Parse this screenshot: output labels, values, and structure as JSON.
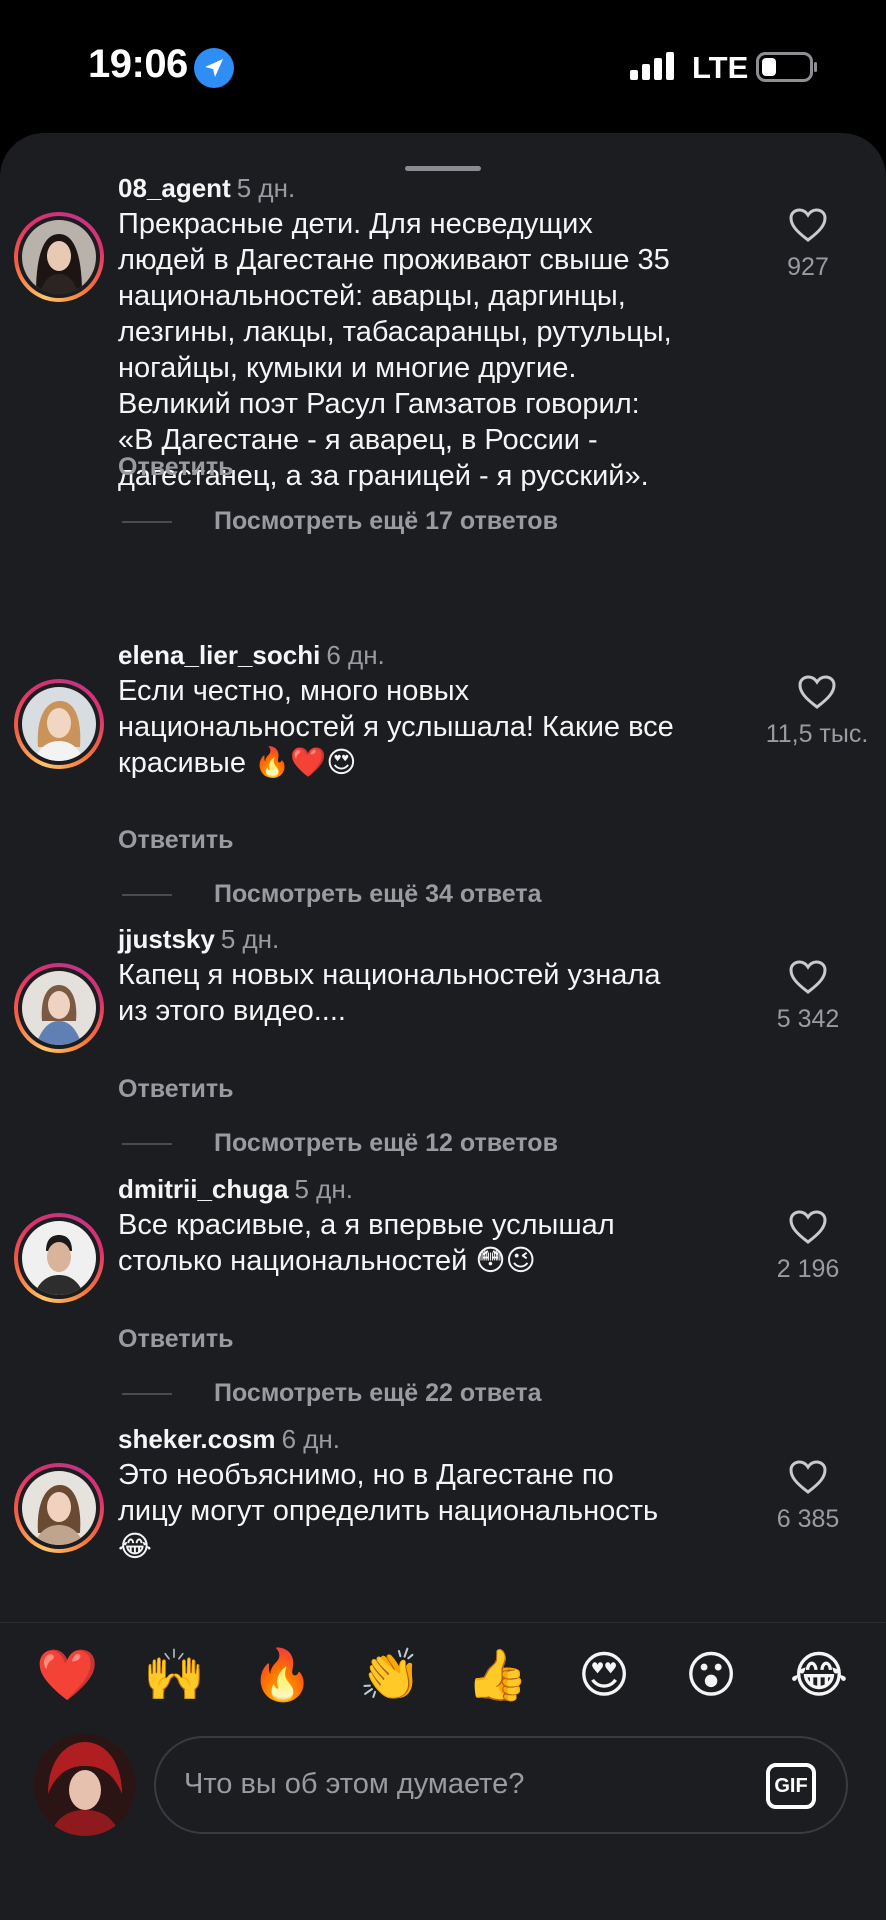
{
  "status_bar": {
    "time": "19:06",
    "network": "LTE"
  },
  "comments": [
    {
      "username": "08_agent",
      "time_ago": "5 дн.",
      "text": "Прекрасные дети. Для несведущих\nлюдей в Дагестане проживают свыше 35\nнациональностей: аварцы, даргинцы,\nлезгины, лакцы, табасаранцы, рутульцы,\nногайцы, кумыки и многие другие.\nВеликий поэт Расул Гамзатов говорил:\n«В Дагестане - я аварец, в России -\nдагестанец, а за границей - я русский».",
      "likes": "927",
      "reply_label": "Ответить",
      "more_replies": "Посмотреть ещё 17 ответов"
    },
    {
      "username": "elena_lier_sochi",
      "time_ago": "6 дн.",
      "text": "Если честно,  много новых\nнациональностей я услышала! Какие все\nкрасивые 🔥❤️😍",
      "likes": "11,5 тыс.",
      "reply_label": "Ответить",
      "more_replies": "Посмотреть ещё 34 ответа"
    },
    {
      "username": "jjustsky",
      "time_ago": "5 дн.",
      "text": "Капец я новых национальностей узнала\nиз этого видео....",
      "likes": "5 342",
      "reply_label": "Ответить",
      "more_replies": "Посмотреть ещё 12 ответов"
    },
    {
      "username": "dmitrii_chuga",
      "time_ago": "5 дн.",
      "text": "Все красивые, а я впервые услышал\nстолько национальностей 😳😉",
      "likes": "2 196",
      "reply_label": "Ответить",
      "more_replies": "Посмотреть ещё 22 ответа"
    },
    {
      "username": "sheker.cosm",
      "time_ago": "6 дн.",
      "text": "Это необъяснимо, но в Дагестане по\nлицу могут определить национальность\n😂",
      "likes": "6 385"
    }
  ],
  "emoji_bar": [
    "❤️",
    "🙌",
    "🔥",
    "👏",
    "👍",
    "😍",
    "😮",
    "😂"
  ],
  "input": {
    "placeholder": "Что вы об этом думаете?",
    "gif_label": "GIF"
  },
  "colors": {
    "background": "#1c1d21",
    "text": "#f5f5f5",
    "muted": "#9a9ba0",
    "location": "#2f8df6"
  }
}
